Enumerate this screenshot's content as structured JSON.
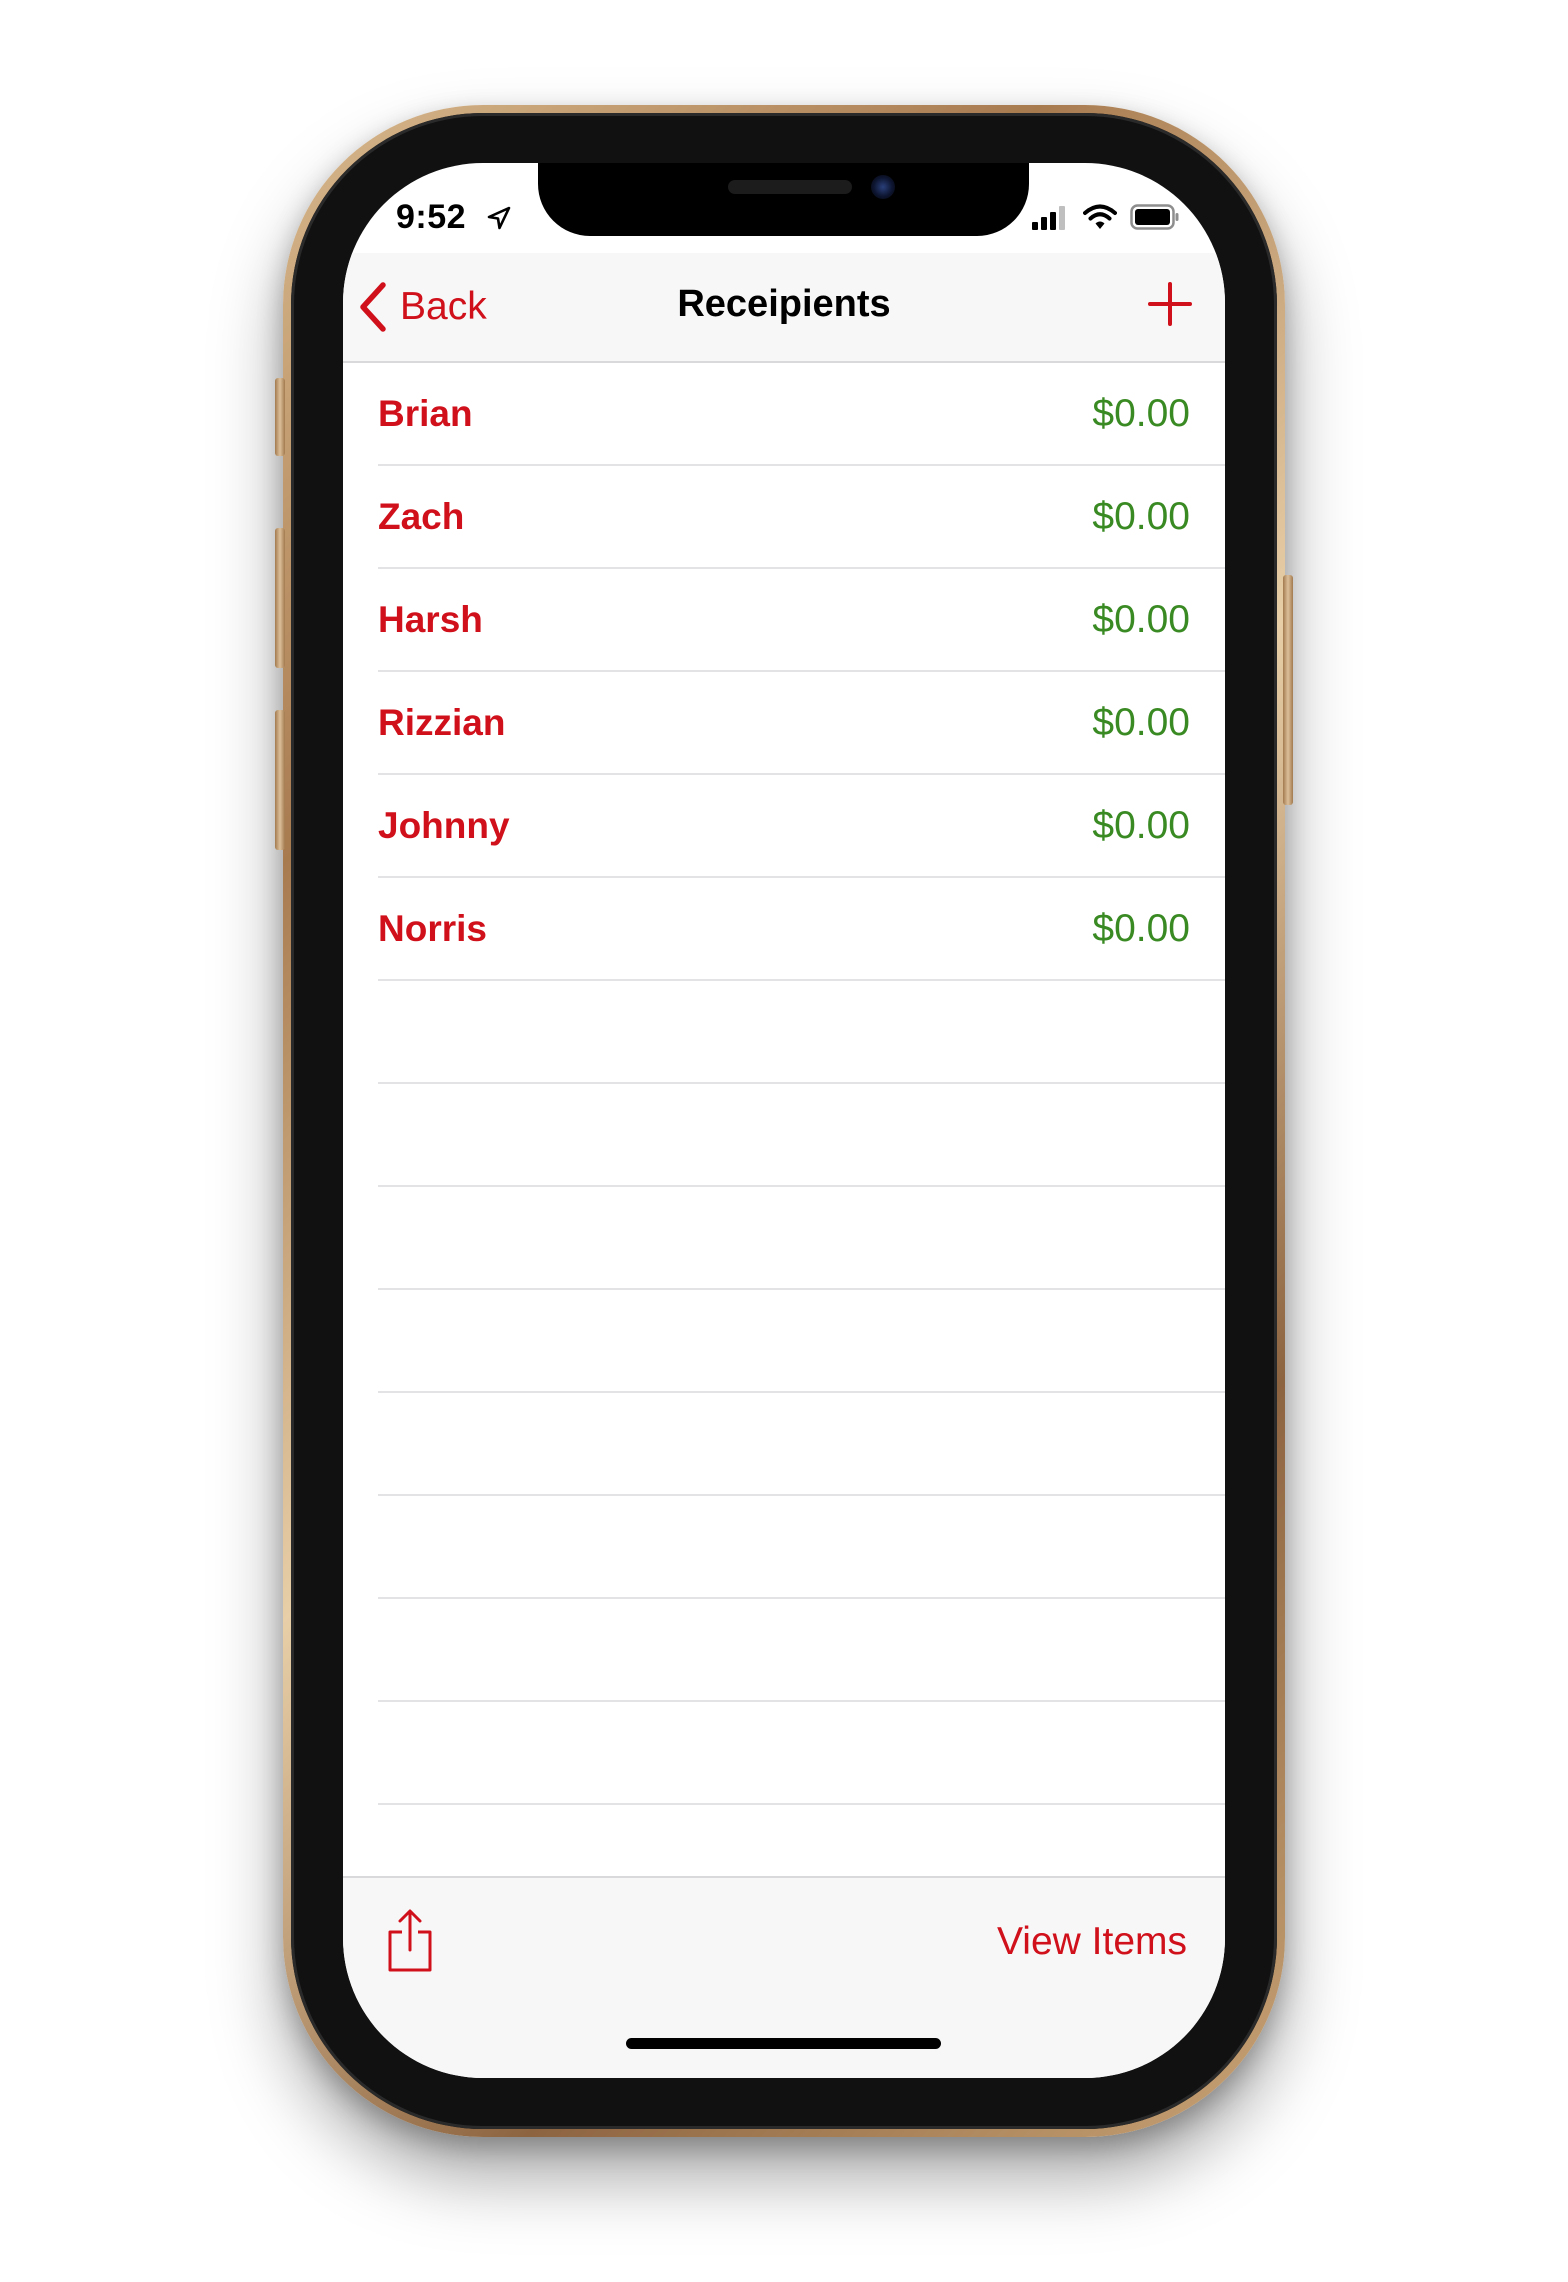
{
  "status_bar": {
    "time": "9:52",
    "location_icon": "location-arrow-icon",
    "signal_icon": "cellular-signal-icon",
    "wifi_icon": "wifi-icon",
    "battery_icon": "battery-icon"
  },
  "nav": {
    "back_label": "Back",
    "title": "Receipients",
    "add_icon": "plus-icon"
  },
  "recipients": [
    {
      "name": "Brian",
      "amount": "$0.00"
    },
    {
      "name": "Zach",
      "amount": "$0.00"
    },
    {
      "name": "Harsh",
      "amount": "$0.00"
    },
    {
      "name": "Rizzian",
      "amount": "$0.00"
    },
    {
      "name": "Johnny",
      "amount": "$0.00"
    },
    {
      "name": "Norris",
      "amount": "$0.00"
    }
  ],
  "toolbar": {
    "share_icon": "share-icon",
    "view_items_label": "View Items"
  },
  "colors": {
    "accent": "#d0101a",
    "amount": "#3a8a23",
    "bar_background": "#f7f7f7"
  }
}
